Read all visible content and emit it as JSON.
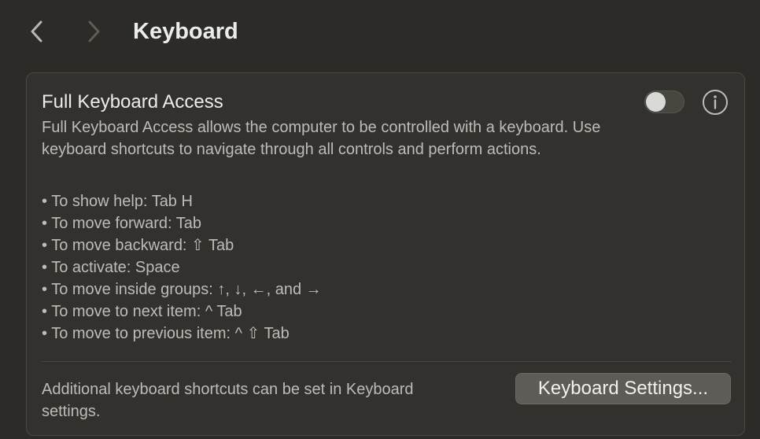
{
  "header": {
    "back_icon": "chevron-left-icon",
    "forward_icon": "chevron-right-icon",
    "title": "Keyboard"
  },
  "full_keyboard_access": {
    "title": "Full Keyboard Access",
    "toggle_state": "off",
    "info_icon": "info-icon",
    "description": "Full Keyboard Access allows the computer to be controlled with a keyboard. Use keyboard shortcuts to navigate through all controls and perform actions.",
    "shortcuts": [
      "• To show help: Tab H",
      "• To move forward: Tab",
      "• To move backward: ⇧ Tab",
      "• To activate: Space",
      "• To move inside groups: ↑, ↓, ←, and →",
      "• To move to next item: ^ Tab",
      "• To move to previous item: ^ ⇧ Tab"
    ],
    "footer_note": "Additional keyboard shortcuts can be set in Keyboard settings.",
    "settings_button_label": "Keyboard Settings..."
  },
  "colors": {
    "background": "#2c2b27",
    "panel": "#32312d",
    "button": "#5d5c57"
  }
}
